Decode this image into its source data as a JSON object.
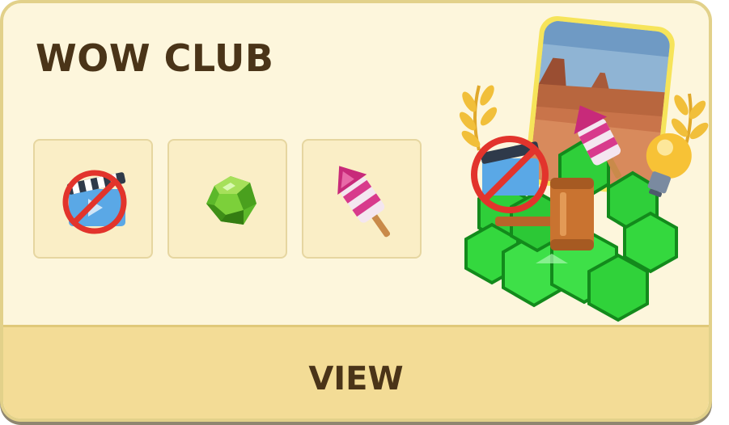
{
  "card": {
    "title": "WOW CLUB",
    "rewards": [
      {
        "icon": "no-ads-icon"
      },
      {
        "icon": "gem-icon"
      },
      {
        "icon": "firework-rocket-icon"
      }
    ],
    "hero_icons": [
      "landscape-photo-icon",
      "hexagon-gems-icon",
      "no-ads-icon",
      "firework-rocket-icon",
      "lightbulb-icon",
      "gavel-icon",
      "laurel-icon"
    ],
    "view_label": "VIEW"
  },
  "colors": {
    "card_background": "#fdf6dc",
    "footer_background": "#f3dc96",
    "text": "#4a3418",
    "tile_background": "#faeec6"
  }
}
